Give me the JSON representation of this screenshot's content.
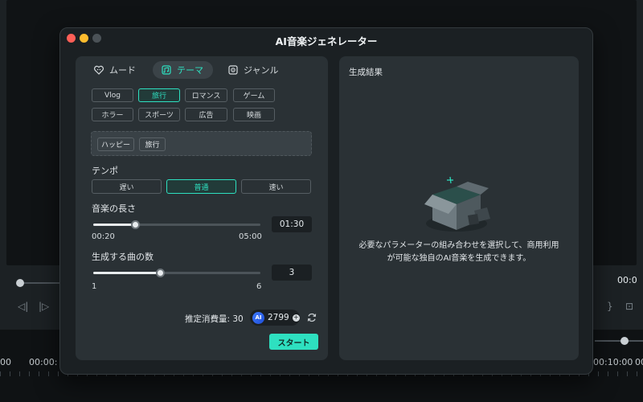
{
  "window": {
    "title": "AI音楽ジェネレーター"
  },
  "tabs": [
    {
      "label": "ムード",
      "icon": "mood-icon"
    },
    {
      "label": "テーマ",
      "icon": "theme-icon",
      "active": true
    },
    {
      "label": "ジャンル",
      "icon": "genre-icon"
    }
  ],
  "theme_chips": [
    "Vlog",
    "旅行",
    "ロマンス",
    "ゲーム",
    "ホラー",
    "スポーツ",
    "広告",
    "映画"
  ],
  "active_theme": "旅行",
  "selected_tags": [
    "ハッピー",
    "旅行"
  ],
  "tempo": {
    "label": "テンポ",
    "options": [
      "遅い",
      "普通",
      "速い"
    ],
    "selected": "普通"
  },
  "duration": {
    "label": "音楽の長さ",
    "min": "00:20",
    "max": "05:00",
    "value": "01:30",
    "fraction": 0.25
  },
  "count": {
    "label": "生成する曲の数",
    "min": "1",
    "max": "6",
    "value": "3",
    "fraction": 0.4
  },
  "cost": {
    "label": "推定消費量: 30",
    "badge": "AI",
    "credits": "2799",
    "plus": "+"
  },
  "start_label": "スタート",
  "result": {
    "title": "生成結果",
    "message": "必要なパラメーターの組み合わせを選択して、商用利用が可能な独自のAI音楽を生成できます。"
  },
  "background": {
    "right_time": "00:0",
    "timeline_labels": [
      "00",
      "00:00:",
      "00:10:00",
      "00:"
    ]
  },
  "colors": {
    "accent": "#2ee0c0",
    "close": "#ff5f57",
    "minimize": "#febc2e",
    "zoom_disabled": "#4b5257"
  }
}
